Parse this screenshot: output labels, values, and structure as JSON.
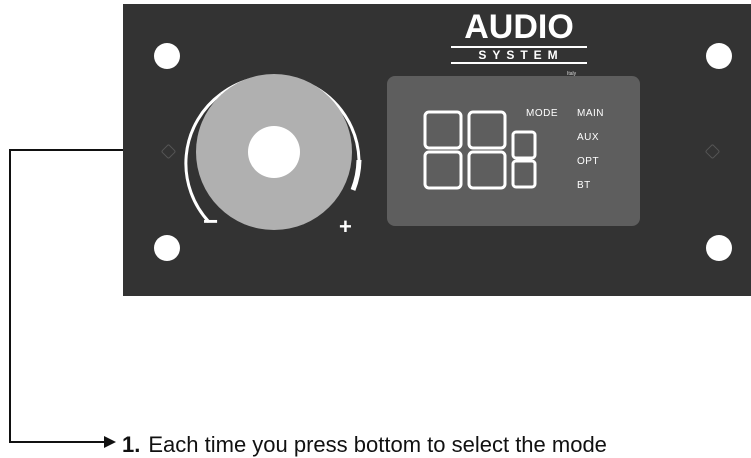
{
  "logo": {
    "line1": "AUDIO",
    "line2": "SYSTEM",
    "line3": "Italy"
  },
  "display": {
    "mode_label": "MODE",
    "inputs": [
      "MAIN",
      "AUX",
      "OPT",
      "BT"
    ]
  },
  "knob": {
    "minus": "−",
    "plus": "+"
  },
  "caption": {
    "number": "1.",
    "text": "Each time you press bottom to select the mode"
  },
  "colors": {
    "panel": "#333333",
    "display": "#5e5e5e",
    "knob": "#b0b0b0",
    "foreground": "#ffffff"
  }
}
